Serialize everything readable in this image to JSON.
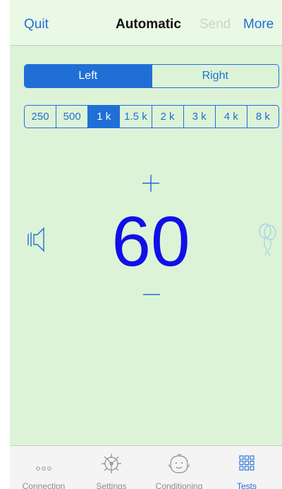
{
  "navbar": {
    "quit": "Quit",
    "title": "Automatic",
    "send": "Send",
    "more": "More"
  },
  "ear": {
    "options": [
      "Left",
      "Right"
    ],
    "selected": "Left"
  },
  "frequency": {
    "options": [
      "250",
      "500",
      "1 k",
      "1.5 k",
      "2 k",
      "3 k",
      "4 k",
      "8 k"
    ],
    "selected": "1 k"
  },
  "level": {
    "value": "60",
    "color": "#1010e8"
  },
  "icons": {
    "increase": "plus-icon",
    "decrease": "minus-icon",
    "speaker": "speaker-icon",
    "response": "balloon-icon"
  },
  "tabbar": {
    "tabs": [
      {
        "label": "Connection",
        "icon": "ellipsis-icon"
      },
      {
        "label": "Settings",
        "icon": "gear-icon"
      },
      {
        "label": "Conditioning",
        "icon": "baby-face-icon"
      },
      {
        "label": "Tests",
        "icon": "grid-icon"
      }
    ],
    "selected": "Tests"
  },
  "colors": {
    "accent": "#1f6fd6",
    "background": "#ddf3d8"
  }
}
